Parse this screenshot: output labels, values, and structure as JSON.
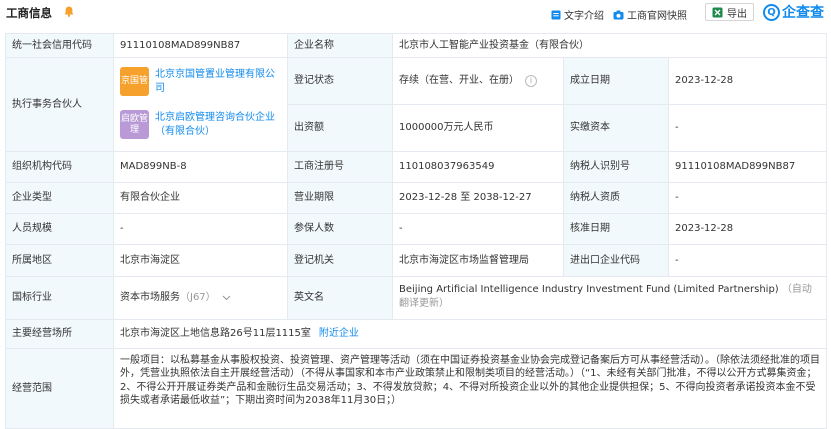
{
  "header": {
    "title": "工商信息",
    "links": {
      "text_intro": "文字介绍",
      "snapshot": "工商官网快照",
      "export": "导出"
    },
    "logo": {
      "mark": "Q",
      "text": "企查查"
    }
  },
  "colors": {
    "accent": "#128bed",
    "label_bg": "#f2f9fc",
    "border": "#e4eaf0",
    "tag_orange": "#f5a12c",
    "tag_purple": "#b99ad6"
  },
  "rows": {
    "credit_code": {
      "label": "统一社会信用代码",
      "value": "91110108MAD899NB87"
    },
    "company_name": {
      "label": "企业名称",
      "value": "北京市人工智能产业投资基金（有限合伙）"
    },
    "partner": {
      "label": "执行事务合伙人",
      "items": [
        {
          "tag": "京国管",
          "name": "北京京国管置业管理有限公司"
        },
        {
          "tag": "启欧管理",
          "name": "北京启欧管理咨询合伙企业（有限合伙）"
        }
      ]
    },
    "status": {
      "label": "登记状态",
      "value": "存续（在营、开业、在册）",
      "info": "i"
    },
    "found_date": {
      "label": "成立日期",
      "value": "2023-12-28"
    },
    "capital": {
      "label": "出资额",
      "value": "1000000万元人民币"
    },
    "paid_capital": {
      "label": "实缴资本",
      "value": "-"
    },
    "org_code": {
      "label": "组织机构代码",
      "value": "MAD899NB-8"
    },
    "reg_no": {
      "label": "工商注册号",
      "value": "110108037963549"
    },
    "tax_id": {
      "label": "纳税人识别号",
      "value": "91110108MAD899NB87"
    },
    "ent_type": {
      "label": "企业类型",
      "value": "有限合伙企业"
    },
    "term": {
      "label": "营业期限",
      "value": "2023-12-28 至 2038-12-27"
    },
    "tax_qual": {
      "label": "纳税人资质",
      "value": "-"
    },
    "staff": {
      "label": "人员规模",
      "value": "-"
    },
    "insured": {
      "label": "参保人数",
      "value": "-"
    },
    "approve_date": {
      "label": "核准日期",
      "value": "2023-12-28"
    },
    "region": {
      "label": "所属地区",
      "value": "北京市海淀区"
    },
    "authority": {
      "label": "登记机关",
      "value": "北京市海淀区市场监督管理局"
    },
    "ie_code": {
      "label": "进出口企业代码",
      "value": "-"
    },
    "industry": {
      "label": "国标行业",
      "value": "资本市场服务",
      "code": "（J67）"
    },
    "english": {
      "label": "英文名",
      "value": "Beijing Artificial Intelligence Industry Investment Fund (Limited Partnership)",
      "translate": "（自动翻译更新）"
    },
    "address": {
      "label": "主要经营场所",
      "value": "北京市海淀区上地信息路26号11层1115室",
      "nearby": "附近企业"
    },
    "scope": {
      "label": "经营范围",
      "value": "一般项目：以私募基金从事股权投资、投资管理、资产管理等活动（须在中国证券投资基金业协会完成登记备案后方可从事经营活动）。（除依法须经批准的项目外，凭营业执照依法自主开展经营活动）（不得从事国家和本市产业政策禁止和限制类项目的经营活动。）（“1、未经有关部门批准，不得以公开方式募集资金；2、不得公开开展证券类产品和金融衍生品交易活动；3、不得发放贷款；4、不得对所投资企业以外的其他企业提供担保；5、不得向投资者承诺投资本金不受损失或者承诺最低收益”；下期出资时间为2038年11月30日；）"
    }
  }
}
